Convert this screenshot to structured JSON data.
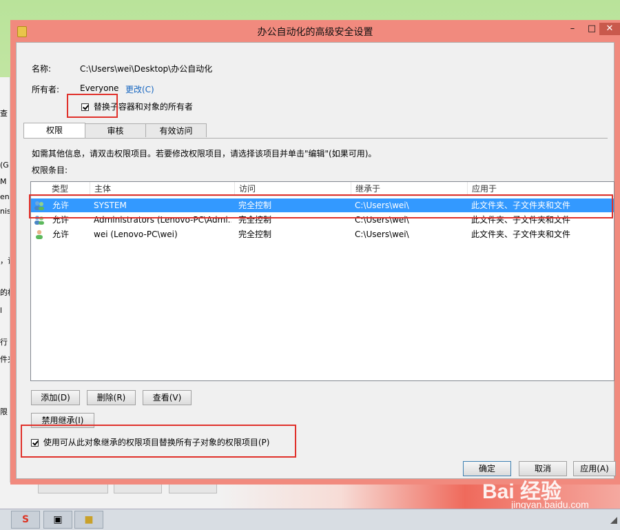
{
  "background_window": {
    "fragments": [
      "查",
      "(G",
      "M",
      "end",
      "nist",
      "，请",
      "的权",
      "l",
      "行",
      "件夹",
      "限"
    ]
  },
  "dialog": {
    "title": "办公自动化的高级安全设置",
    "name_label": "名称:",
    "name_value": "C:\\Users\\wei\\Desktop\\办公自动化",
    "owner_label": "所有者:",
    "owner_value": "Everyone",
    "owner_change_link": "更改(C)",
    "replace_owner_checkbox": "替换子容器和对象的所有者",
    "tabs": [
      "权限",
      "审核",
      "有效访问"
    ],
    "info_text": "如需其他信息，请双击权限项目。若要修改权限项目，请选择该项目并单击\"编辑\"(如果可用)。",
    "entries_label": "权限条目:",
    "columns": [
      "类型",
      "主体",
      "访问",
      "继承于",
      "应用于"
    ],
    "rows": [
      {
        "type": "允许",
        "principal": "SYSTEM",
        "access": "完全控制",
        "inherited_from": "C:\\Users\\wei\\",
        "applies_to": "此文件夹、子文件夹和文件",
        "icon": "group-users-icon"
      },
      {
        "type": "允许",
        "principal": "Administrators (Lenovo-PC\\Admi...",
        "access": "完全控制",
        "inherited_from": "C:\\Users\\wei\\",
        "applies_to": "此文件夹、子文件夹和文件",
        "icon": "group-users-icon"
      },
      {
        "type": "允许",
        "principal": "wei (Lenovo-PC\\wei)",
        "access": "完全控制",
        "inherited_from": "C:\\Users\\wei\\",
        "applies_to": "此文件夹、子文件夹和文件",
        "icon": "user-icon"
      }
    ],
    "selected_row": 0,
    "buttons": {
      "add": "添加(D)",
      "remove": "删除(R)",
      "view": "查看(V)",
      "disable_inheritance": "禁用继承(I)",
      "ok": "确定",
      "cancel": "取消",
      "apply": "应用(A)"
    },
    "replace_child_checkbox": "使用可从此对象继承的权限项目替换所有子对象的权限项目(P)",
    "replace_owner_checked": true,
    "replace_child_checked": true
  },
  "watermark": {
    "brand": "Bai 经验",
    "url": "jingyan.baidu.com"
  },
  "colors": {
    "dialog_frame": "#f18a7e",
    "selection": "#3399ff",
    "highlight_box": "#e0302a",
    "link": "#1565c0"
  }
}
